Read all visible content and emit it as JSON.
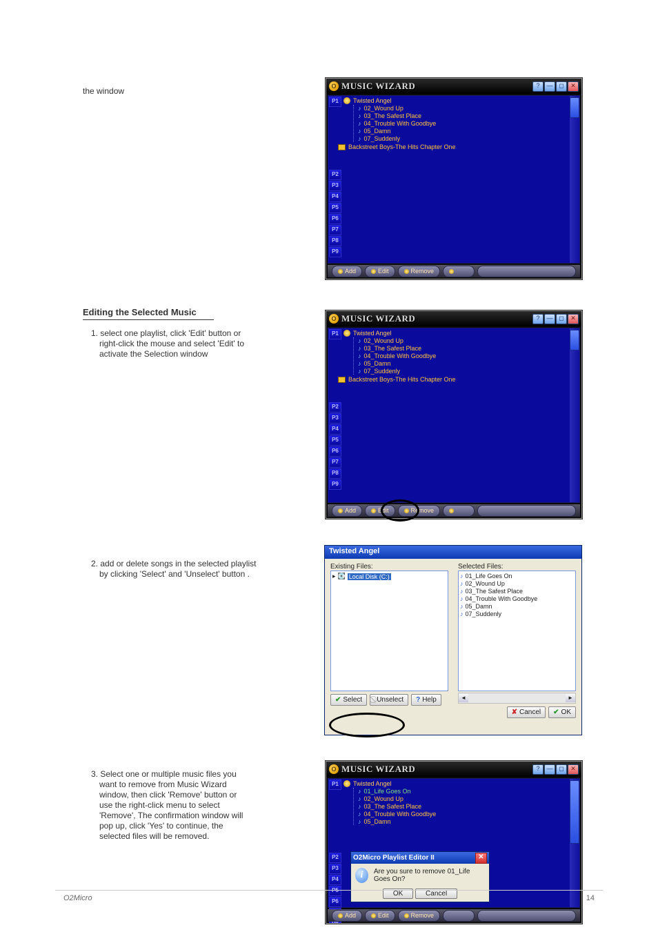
{
  "page": {
    "number": "14"
  },
  "footer_brand": "O2Micro",
  "left_text": {
    "line1": "the window",
    "line2_main": "Editing the Selected Music",
    "step1_a": "1. select one playlist, click 'Edit' button or",
    "step1_b": "right-click the mouse and select 'Edit' to",
    "step1_c": "activate the Selection window",
    "step2_a": "2. add or delete songs in the selected playlist",
    "step2_b": "by clicking 'Select' and 'Unselect' button .",
    "step3_a": "3. Select one or multiple music files you",
    "step3_b": "want to remove from Music Wizard",
    "step3_c": "window, then click 'Remove' button or",
    "step3_d": "use the right-click menu to select",
    "step3_e": "'Remove', The confirmation window will",
    "step3_f": "pop up, click 'Yes' to continue, the",
    "step3_g": "selected files will be removed."
  },
  "mw": {
    "title": "MUSIC WIZARD",
    "album": "Twisted Angel",
    "tracks": {
      "t1": "01_Life Goes On",
      "t2": "02_Wound Up",
      "t3": "03_The Safest Place",
      "t4": "04_Trouble With Goodbye",
      "t5": "05_Damn",
      "t6": "07_Suddenly"
    },
    "other_album": "Backstreet Boys-The Hits Chapter One",
    "slots": {
      "p1": "P1",
      "p2": "P2",
      "p3": "P3",
      "p4": "P4",
      "p5": "P5",
      "p6": "P6",
      "p7": "P7",
      "p8": "P8",
      "p9": "P9"
    },
    "footer": {
      "add": "Add",
      "edit": "Edit",
      "remove": "Remove"
    }
  },
  "selection_dialog": {
    "title": "Twisted Angel",
    "existing_label": "Existing Files:",
    "selected_label": "Selected Files:",
    "drive": "Local Disk (C:)",
    "buttons": {
      "select": "Select",
      "unselect": "Unselect",
      "help": "Help",
      "cancel": "Cancel",
      "ok": "OK"
    },
    "selected_files": {
      "f1": "01_Life Goes On",
      "f2": "02_Wound Up",
      "f3": "03_The Safest Place",
      "f4": "04_Trouble With Goodbye",
      "f5": "05_Damn",
      "f6": "07_Suddenly"
    }
  },
  "confirm_dialog": {
    "title": "O2Micro Playlist Editor II",
    "message": "Are you sure to remove 01_Life Goes On?",
    "ok": "OK",
    "cancel": "Cancel"
  }
}
